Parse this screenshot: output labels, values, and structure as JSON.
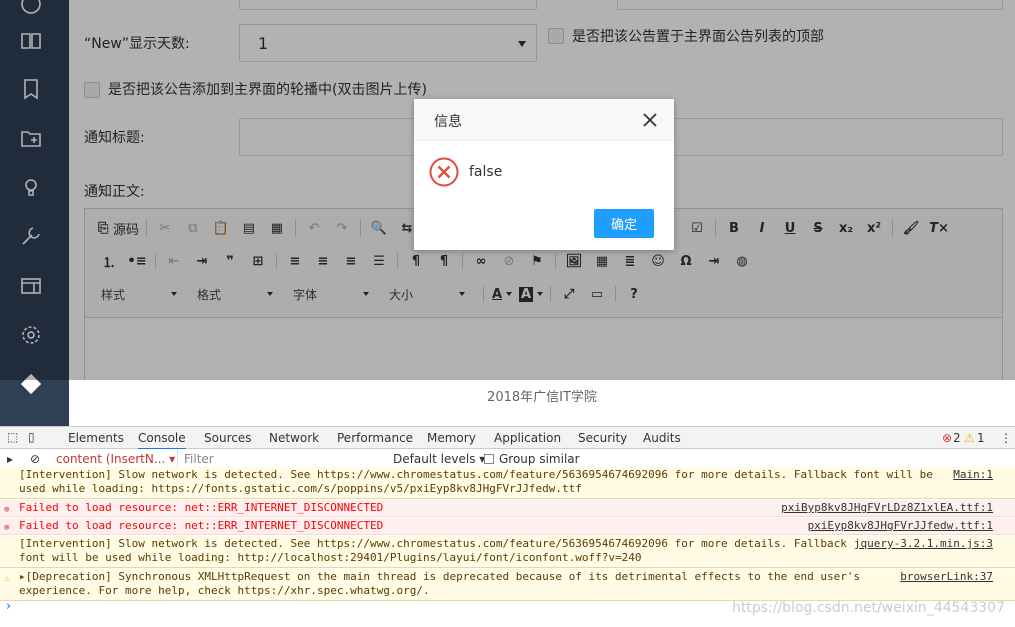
{
  "form": {
    "new_days_label": "“New”显示天数:",
    "new_days_value": "1",
    "pin_top_label": "是否把该公告置于主界面公告列表的顶部",
    "carousel_label": "是否把该公告添加到主界面的轮播中(双击图片上传)",
    "title_label": "通知标题:",
    "body_label": "通知正文:"
  },
  "editor": {
    "source_label": "源码",
    "combo_style": "样式",
    "combo_format": "格式",
    "combo_font": "字体",
    "combo_size": "大小",
    "bold": "B",
    "italic": "I",
    "underline": "U",
    "strike": "S",
    "subscript": "x₂",
    "superscript": "x²",
    "help": "?"
  },
  "footer": {
    "text": "2018年广信IT学院"
  },
  "dialog": {
    "title": "信息",
    "message": "false",
    "ok_label": "确定"
  },
  "devtools": {
    "tabs": [
      "Elements",
      "Console",
      "Sources",
      "Network",
      "Performance",
      "Memory",
      "Application",
      "Security",
      "Audits"
    ],
    "active_tab": "Console",
    "error_count": "2",
    "warning_count": "1",
    "context": "content (InsertN...",
    "filter_placeholder": "Filter",
    "levels": "Default levels",
    "group_similar": "Group similar",
    "logs": [
      {
        "type": "warn",
        "line1": "[Intervention] Slow network is detected. See https://www.chromestatus.com/feature/5636954674692096 for more details. Fallback font will be",
        "line2": "used while loading: https://fonts.gstatic.com/s/poppins/v5/pxiEyp8kv8JHgFVrJJfedw.ttf",
        "source": "Main:1"
      },
      {
        "type": "err",
        "line1": "Failed to load resource: net::ERR_INTERNET_DISCONNECTED",
        "source": "pxiByp8kv8JHgFVrLDz8Z1xlEA.ttf:1"
      },
      {
        "type": "err",
        "line1": "Failed to load resource: net::ERR_INTERNET_DISCONNECTED",
        "source": "pxiEyp8kv8JHgFVrJJfedw.ttf:1"
      },
      {
        "type": "warn",
        "line1": "[Intervention] Slow network is detected. See https://www.chromestatus.com/feature/5636954674692096 for more details. Fallback",
        "line2": "font will be used while loading: http://localhost:29401/Plugins/layui/font/iconfont.woff?v=240",
        "source": "jquery-3.2.1.min.js:3"
      },
      {
        "type": "warn",
        "line1": "▸[Deprecation] Synchronous XMLHttpRequest on the main thread is deprecated because of its detrimental effects to the end user's",
        "line2": "experience. For more help, check https://xhr.spec.whatwg.org/.",
        "source": "browserLink:37"
      }
    ],
    "prompt": "›"
  },
  "watermark": "https://blog.csdn.net/weixin_44543307",
  "colors": {
    "sidebar": "#2f4056",
    "ok_button": "#1e9fff",
    "error_icon": "#e74c3c"
  }
}
